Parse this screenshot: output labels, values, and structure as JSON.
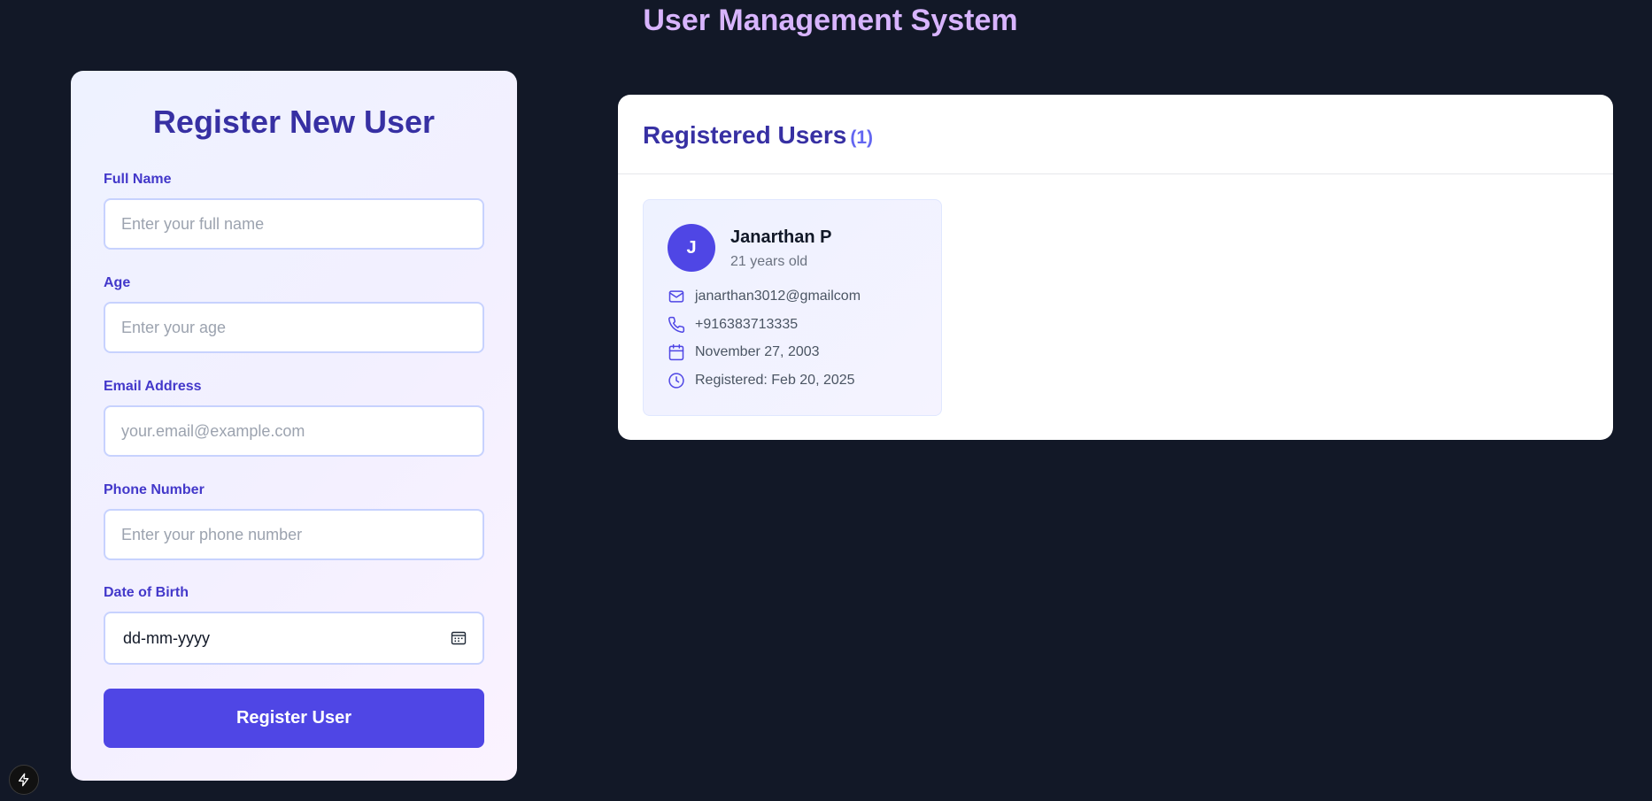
{
  "app": {
    "title": "User Management System"
  },
  "register_form": {
    "title": "Register New User",
    "fields": {
      "full_name": {
        "label": "Full Name",
        "placeholder": "Enter your full name",
        "value": ""
      },
      "age": {
        "label": "Age",
        "placeholder": "Enter your age",
        "value": ""
      },
      "email": {
        "label": "Email Address",
        "placeholder": "your.email@example.com",
        "value": ""
      },
      "phone": {
        "label": "Phone Number",
        "placeholder": "Enter your phone number",
        "value": ""
      },
      "dob": {
        "label": "Date of Birth",
        "value": "dd-mm-yyyy",
        "icon": "calendar-picker-icon"
      }
    },
    "submit_label": "Register User"
  },
  "users_panel": {
    "title": "Registered Users",
    "count_text": "(1)",
    "users": [
      {
        "initial": "J",
        "name": "Janarthan P",
        "age_text": "21 years old",
        "email": "janarthan3012@gmailcom",
        "phone": "+916383713335",
        "dob": "November 27, 2003",
        "registered": "Registered: Feb 20, 2025"
      }
    ]
  },
  "dev_indicator": {
    "icon": "lightning-bolt-icon"
  },
  "colors": {
    "background": "#121827",
    "title": "#d8b4fe",
    "accent": "#4f46e5",
    "heading": "#3730a3",
    "label": "#4338ca"
  }
}
